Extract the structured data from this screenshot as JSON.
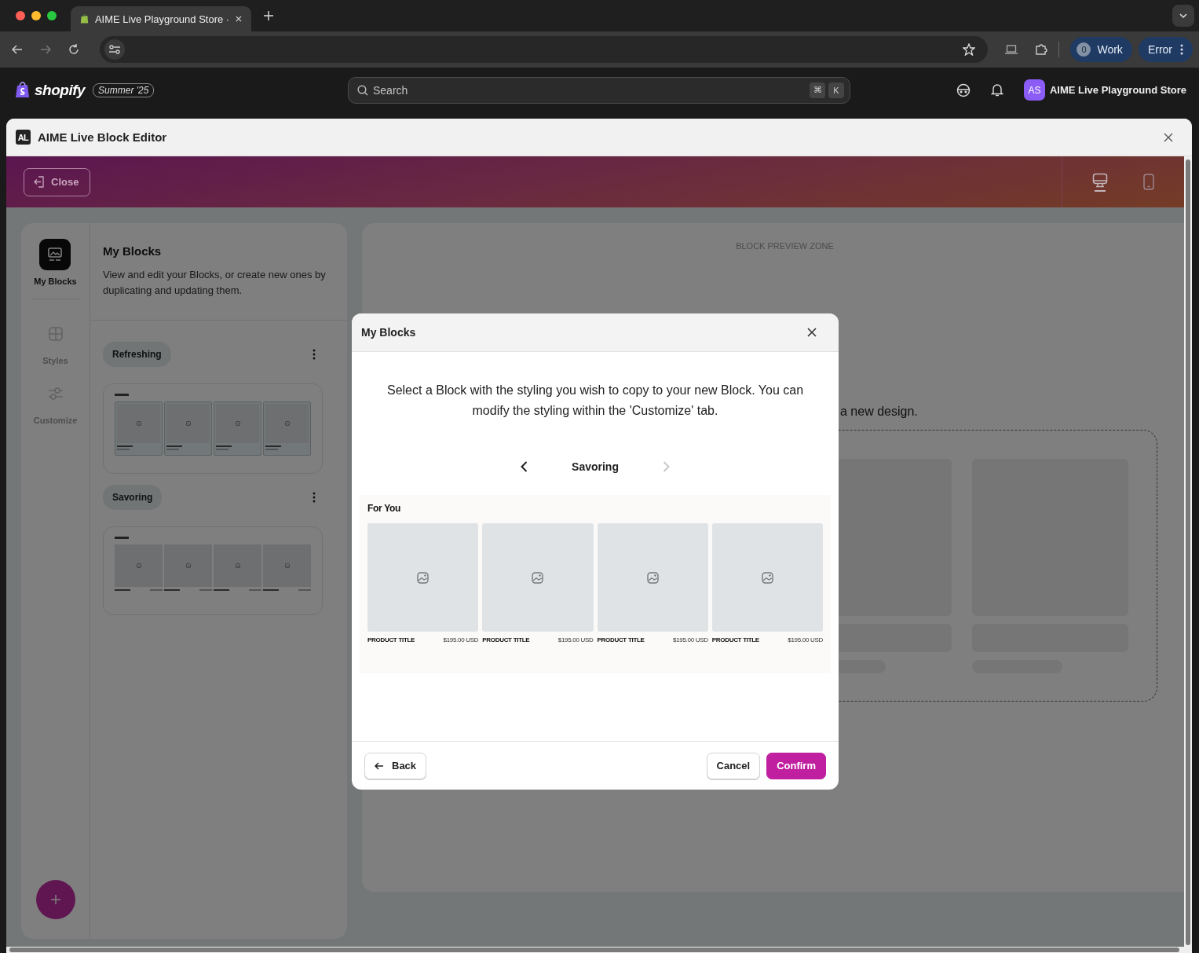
{
  "browser": {
    "tab_title": "AIME Live Playground Store ·",
    "profile_count": "0",
    "profile_name": "Work",
    "error_label": "Error"
  },
  "admin_bar": {
    "logo": "shopify",
    "edition": "Summer '25",
    "search": {
      "placeholder": "Search"
    },
    "shortcut_keys": [
      "⌘",
      "K"
    ],
    "store_initials": "AS",
    "store_name": "AIME Live Playground Store"
  },
  "editor": {
    "logo_letters": "AL",
    "title": "AIME Live Block Editor",
    "close_button": "Close",
    "devices": [
      {
        "kind": "desktop",
        "selected": true
      },
      {
        "kind": "mobile",
        "selected": false
      }
    ],
    "rail": [
      {
        "kind": "blocks",
        "label": "My Blocks",
        "selected": true
      },
      {
        "kind": "styles",
        "label": "Styles",
        "selected": false
      },
      {
        "kind": "customize",
        "label": "Customize",
        "selected": false
      }
    ],
    "panel": {
      "title": "My Blocks",
      "description": "View and edit your Blocks, or create new ones by duplicating and updating them.",
      "blocks": [
        {
          "name": "Refreshing",
          "kind": "cards"
        },
        {
          "name": "Savoring",
          "kind": "plain"
        }
      ]
    },
    "preview_zone": {
      "label": "BLOCK PREVIEW ZONE",
      "hint": "a new design."
    }
  },
  "modal": {
    "title": "My Blocks",
    "message": "Select a Block with the styling you wish to copy to your new Block. You can modify the styling within the 'Customize' tab.",
    "current": "Savoring",
    "prev_disabled": false,
    "next_disabled": true,
    "preview": {
      "title": "For You",
      "products": [
        {
          "title": "PRODUCT TITLE",
          "price": "$195.00 USD"
        },
        {
          "title": "PRODUCT TITLE",
          "price": "$195.00 USD"
        },
        {
          "title": "PRODUCT TITLE",
          "price": "$195.00 USD"
        },
        {
          "title": "PRODUCT TITLE",
          "price": "$195.00 USD"
        }
      ]
    },
    "back_button": "Back",
    "cancel_button": "Cancel",
    "confirm_button": "Confirm"
  }
}
